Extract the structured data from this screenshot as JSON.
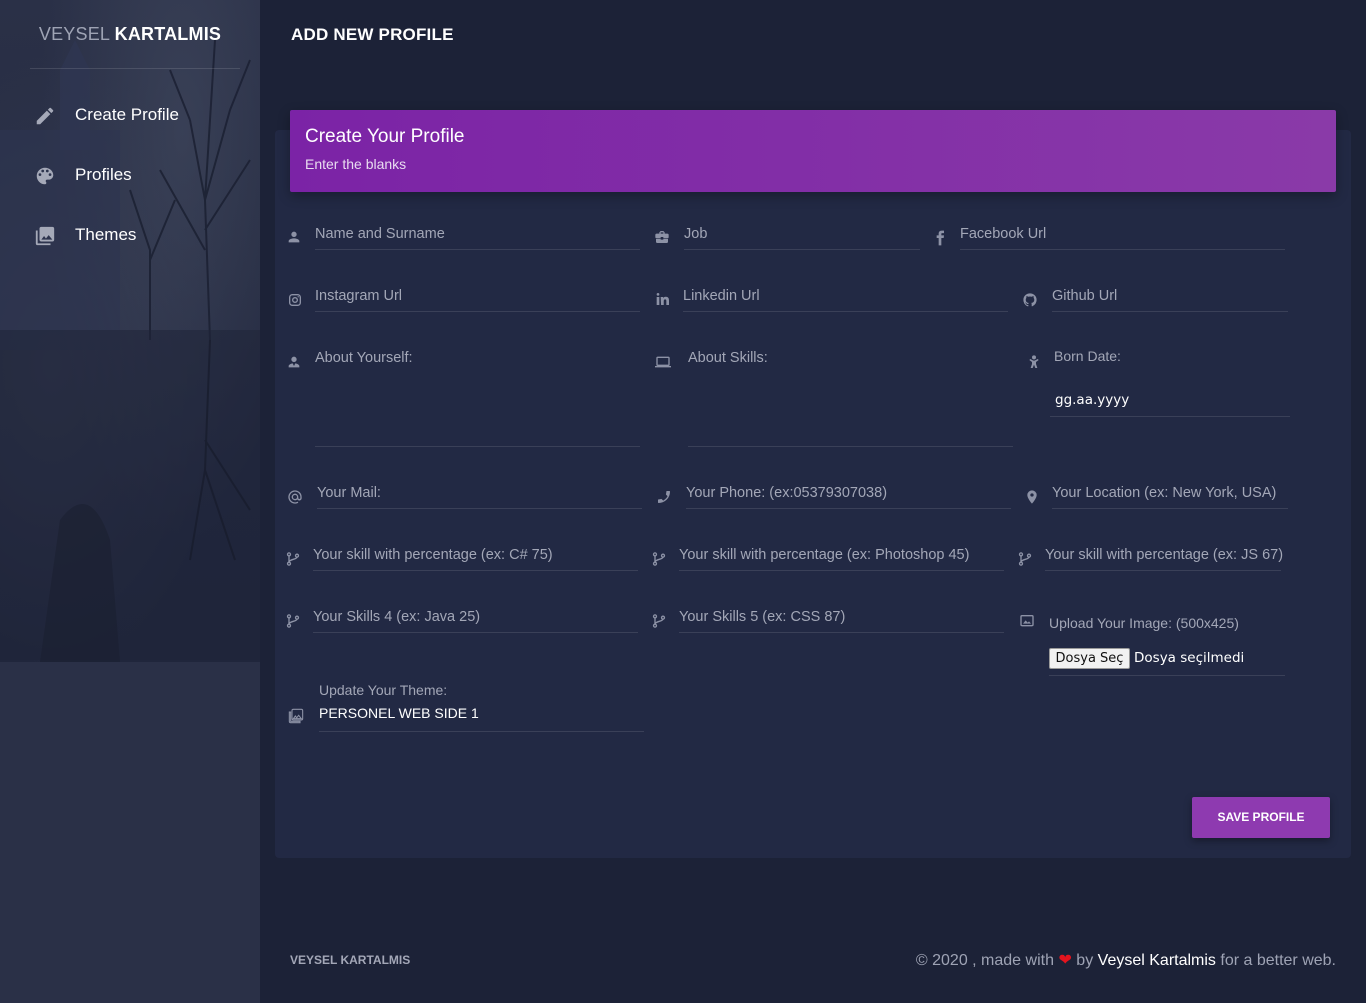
{
  "sidebar": {
    "brand_first": "VEYSEL",
    "brand_last": "KARTALMIS",
    "items": [
      {
        "label": "Create Profile",
        "icon": "pencil-icon"
      },
      {
        "label": "Profiles",
        "icon": "palette-icon"
      },
      {
        "label": "Themes",
        "icon": "gallery-icon"
      }
    ]
  },
  "page": {
    "title": "ADD NEW PROFILE"
  },
  "card": {
    "title": "Create Your Profile",
    "subtitle": "Enter the blanks",
    "header_color": "#7b23a6"
  },
  "form": {
    "name_placeholder": "Name and Surname",
    "job_placeholder": "Job",
    "facebook_placeholder": "Facebook Url",
    "instagram_placeholder": "Instagram Url",
    "linkedin_placeholder": "Linkedin Url",
    "github_placeholder": "Github Url",
    "about_yourself_placeholder": "About Yourself:",
    "about_skills_placeholder": "About Skills:",
    "born_date_label": "Born Date:",
    "born_date_value": "gg.aa.yyyy",
    "mail_placeholder": "Your Mail:",
    "phone_placeholder": "Your Phone: (ex:05379307038)",
    "location_placeholder": "Your Location (ex: New York, USA)",
    "skill1_placeholder": "Your skill with percentage (ex: C# 75)",
    "skill2_placeholder": "Your skill with percentage (ex: Photoshop 45)",
    "skill3_placeholder": "Your skill with percentage (ex: JS 67)",
    "skill4_placeholder": "Your Skills 4 (ex: Java 25)",
    "skill5_placeholder": "Your Skills 5 (ex: CSS 87)",
    "upload_label": "Upload Your Image: (500x425)",
    "file_button": "Dosya Seç",
    "file_status": "Dosya seçilmedi",
    "theme_label": "Update Your Theme:",
    "theme_value": "PERSONEL WEB SIDE 1",
    "save_button": "SAVE PROFILE",
    "save_color": "#8e3ab0"
  },
  "footer": {
    "left": "VEYSEL KARTALMIS",
    "copyright": "© 2020 , made with",
    "by": "by",
    "author": "Veysel Kartalmis",
    "tail": "for a better web.",
    "heart_color": "#e4141e"
  }
}
